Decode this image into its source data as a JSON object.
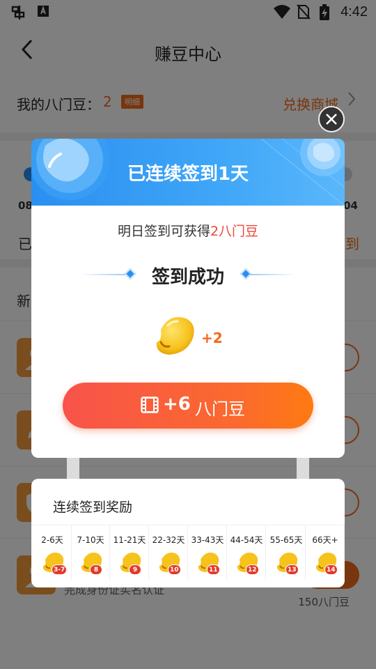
{
  "status_bar": {
    "left_icons": [
      "app-notification-icon",
      "a-keyboard-icon"
    ],
    "right_icons": [
      "wifi-icon",
      "no-sim-icon",
      "battery-charging-icon"
    ],
    "time": "4:42"
  },
  "header": {
    "back_icon": "chevron-left-icon",
    "title": "赚豆中心"
  },
  "beans": {
    "label": "我的八门豆：",
    "count": "2",
    "detail_tag": "明细",
    "shop_link": "兑换商城"
  },
  "checkin_bg": {
    "date_left": "08",
    "date_right": "04",
    "text_left": "已",
    "text_right": "到"
  },
  "tasks": {
    "title": "新",
    "row4_sub": "完成身份证实名认证",
    "row4_reward": "150八门豆"
  },
  "dialog": {
    "close_icon": "close-icon",
    "title": "已连续签到1天",
    "subtitle_prefix": "明日签到可获得",
    "subtitle_highlight": "2八门豆",
    "success_text": "签到成功",
    "gain": "+2",
    "video_button": {
      "icon": "film-icon",
      "amount": "+6",
      "unit": "八门豆"
    }
  },
  "rewards": {
    "title": "连续签到奖励",
    "items": [
      {
        "days": "2-6天",
        "badge": "3-7"
      },
      {
        "days": "7-10天",
        "badge": "8"
      },
      {
        "days": "11-21天",
        "badge": "9"
      },
      {
        "days": "22-32天",
        "badge": "10"
      },
      {
        "days": "33-43天",
        "badge": "11"
      },
      {
        "days": "44-54天",
        "badge": "12"
      },
      {
        "days": "55-65天",
        "badge": "13"
      },
      {
        "days": "66天+",
        "badge": "14"
      }
    ]
  },
  "colors": {
    "accent_orange": "#f26a1b",
    "header_blue": "#2a8ff0",
    "highlight_red": "#f0443a",
    "bean_yellow": "#f6c21c"
  }
}
